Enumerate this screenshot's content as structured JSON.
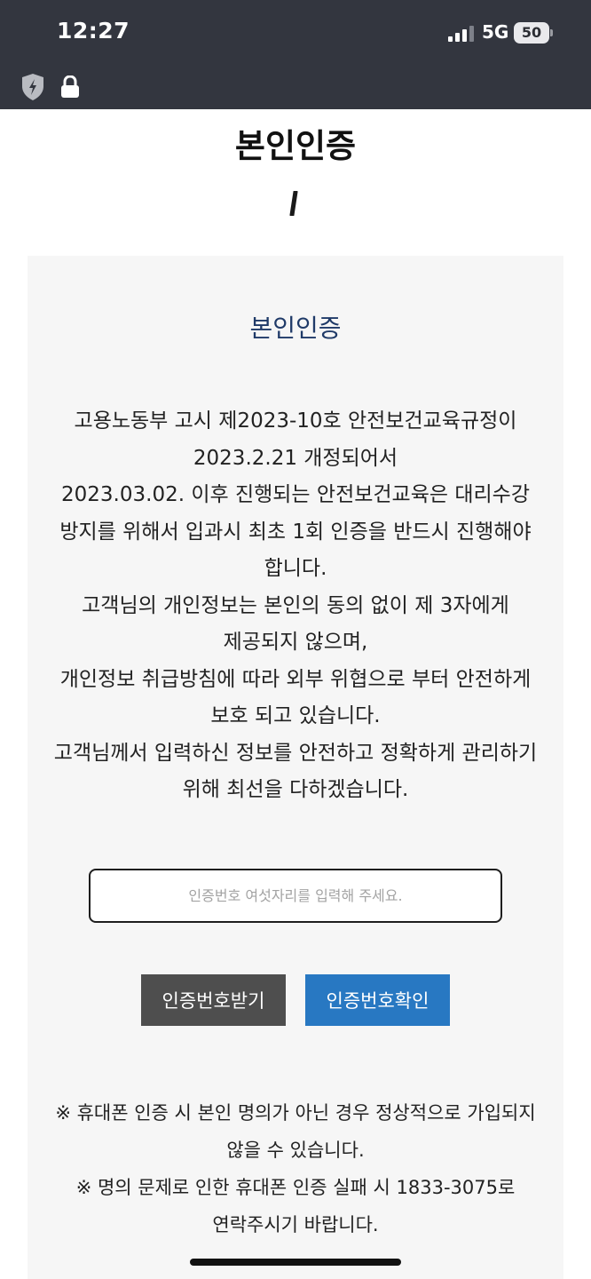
{
  "status_bar": {
    "time": "12:27",
    "network": "5G",
    "battery": "50",
    "icons": [
      "signal-icon",
      "battery-icon",
      "shield-bolt-icon",
      "lock-icon"
    ]
  },
  "page": {
    "title": "본인인증"
  },
  "card": {
    "title": "본인인증",
    "notice_lines": [
      "고용노동부 고시 제2023-10호 안전보건교육규정이",
      "2023.2.21 개정되어서",
      "2023.03.02. 이후 진행되는 안전보건교육은 대리수강",
      "방지를 위해서 입과시 최초 1회 인증을 반드시 진행해야",
      "합니다.",
      "고객님의 개인정보는 본인의 동의 없이 제 3자에게",
      "제공되지 않으며,",
      "개인정보 취급방침에 따라 외부 위협으로 부터 안전하게",
      "보호 되고 있습니다.",
      "고객님께서 입력하신 정보를 안전하고 정확하게 관리하기",
      "위해 최선을 다하겠습니다."
    ],
    "code_input": {
      "value": "",
      "placeholder": "인증번호 여섯자리를 입력해 주세요."
    },
    "buttons": {
      "request_label": "인증번호받기",
      "confirm_label": "인증번호확인"
    },
    "footnote_lines": [
      "※ 휴대폰 인증 시 본인 명의가 아닌 경우 정상적으로 가입되지",
      "않을 수 있습니다.",
      "※ 명의 문제로 인한 휴대폰 인증 실패 시 1833-3075로",
      "연락주시기 바랍니다."
    ]
  },
  "colors": {
    "topbar": "#33363f",
    "card_background": "#f6f6f6",
    "card_title": "#1f3a68",
    "request_button": "#4e4e4e",
    "confirm_button": "#2878c2"
  }
}
